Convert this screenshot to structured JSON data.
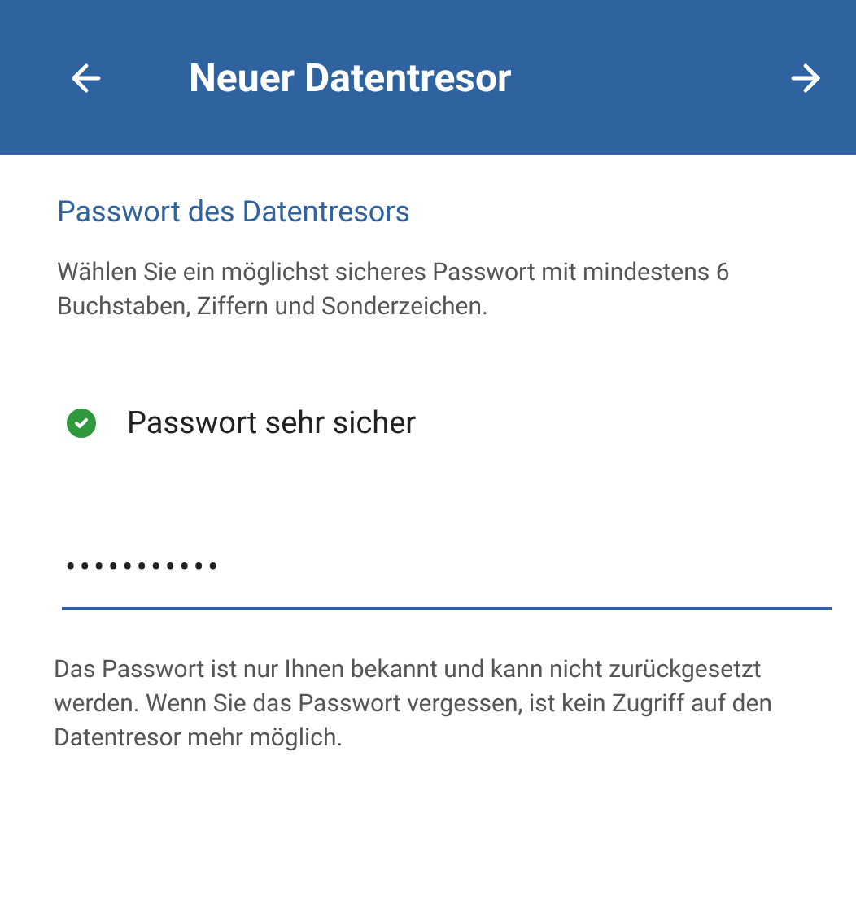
{
  "header": {
    "title": "Neuer Datentresor"
  },
  "section": {
    "title": "Passwort des Datentresors",
    "description": "Wählen Sie ein möglichst sicheres Passwort mit mindestens 6 Buchstaben, Ziffern und Sonderzeichen."
  },
  "strength": {
    "label": "Passwort sehr sicher",
    "ok": true
  },
  "password_field": {
    "value": "•••••••••••",
    "focused": true
  },
  "note": "Das Passwort ist nur Ihnen bekannt und kann nicht zurückgesetzt werden. Wenn Sie das Passwort vergessen, ist kein Zugriff auf den Datentresor mehr möglich."
}
